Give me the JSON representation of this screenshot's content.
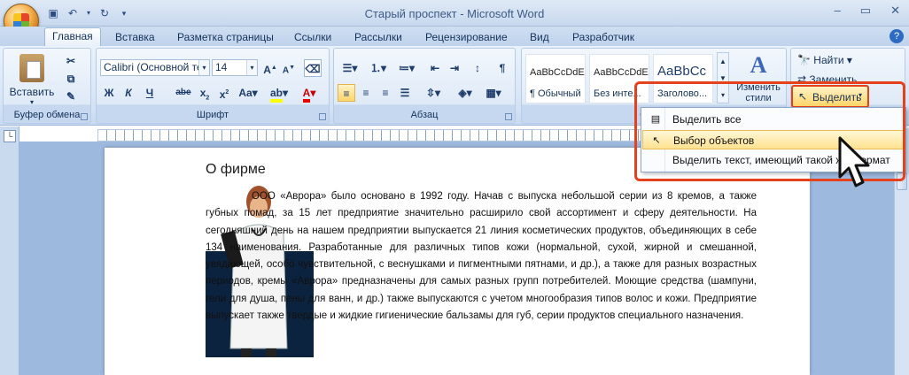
{
  "window": {
    "title": "Старый проспект - Microsoft Word",
    "quick_access": [
      "save-icon",
      "undo-icon",
      "redo-icon",
      "customize-icon"
    ]
  },
  "tabs": [
    "Главная",
    "Вставка",
    "Разметка страницы",
    "Ссылки",
    "Рассылки",
    "Рецензирование",
    "Вид",
    "Разработчик"
  ],
  "active_tab": "Главная",
  "ribbon": {
    "clipboard": {
      "label": "Буфер обмена",
      "paste": "Вставить"
    },
    "font": {
      "label": "Шрифт",
      "font_name": "Calibri (Основной те",
      "font_size": "14"
    },
    "paragraph": {
      "label": "Абзац"
    },
    "styles": {
      "label": "Стили",
      "items": [
        {
          "preview": "AaBbCcDdE",
          "name": "¶ Обычный"
        },
        {
          "preview": "AaBbCcDdE",
          "name": "Без инте..."
        },
        {
          "preview": "AaBbCc",
          "name": "Заголово..."
        }
      ],
      "change_styles": "Изменить стили"
    },
    "editing": {
      "find": "Найти",
      "replace": "Заменить",
      "select": "Выделить"
    }
  },
  "select_menu": {
    "items": [
      "Выделить все",
      "Выбор объектов",
      "Выделить текст, имеющий такой же формат"
    ],
    "highlighted_index": 1
  },
  "document": {
    "heading": "О фирме",
    "body": "ООО «Аврора» было основано в 1992 году. Начав с выпуска небольшой серии из 8 кремов, а также губных помад, за 15 лет предприятие значительно расширило свой ассортимент и сферу деятельности. На сегодняшний день на нашем предприятии выпускается 21 линия косметических продуктов, объединяющих в себе 134 наименования. Разработанные для различных типов кожи (нормальной, сухой, жирной и смешанной, увядающей, особо чувствительной, с веснушками и пигментными пятнами, и др.), а также для разных возрастных периодов, кремы «Аврора» предназначены для самых разных групп потребителей. Моющие средства (шампуни, гели для душа, пены для ванн, и др.) также выпускаются с учетом многообразия типов волос и кожи. Предприятие выпускает также твердые и жидкие гигиенические бальзамы для губ, серии продуктов специального назначения."
  },
  "colors": {
    "highlight_box": "#e4411c",
    "menu_highlight": "#ffe291",
    "ribbon_bg": "#dbe7f6"
  }
}
